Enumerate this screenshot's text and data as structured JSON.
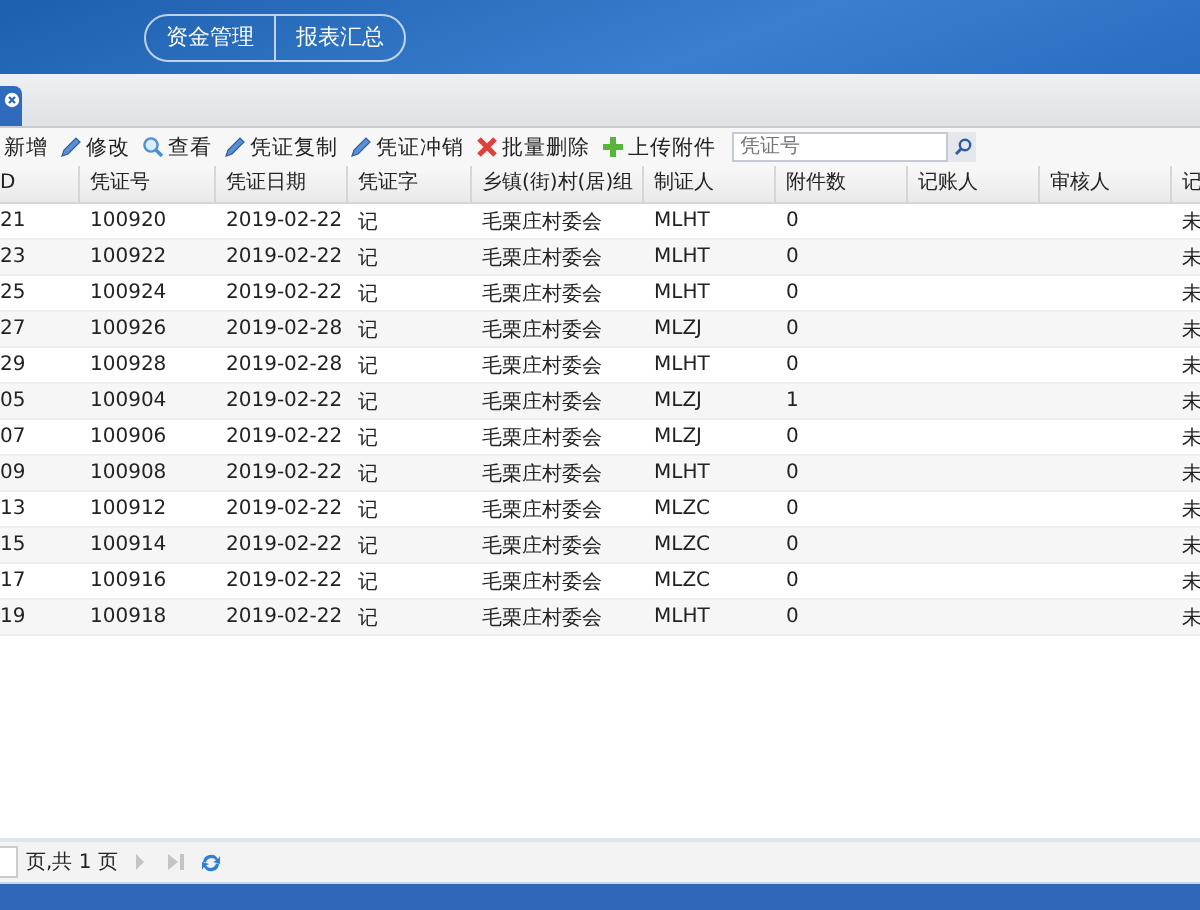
{
  "nav": [
    "资金管理",
    "报表汇总"
  ],
  "toolbar": [
    {
      "label": "新增"
    },
    {
      "label": "修改",
      "kind": "pencil"
    },
    {
      "label": "查看",
      "kind": "search"
    },
    {
      "label": "凭证复制",
      "kind": "pencil"
    },
    {
      "label": "凭证冲销",
      "kind": "pencil"
    },
    {
      "label": "批量删除",
      "kind": "delete"
    },
    {
      "label": "上传附件",
      "kind": "add"
    }
  ],
  "search": {
    "placeholder": "凭证号"
  },
  "table": {
    "columns": [
      "D",
      "凭证号",
      "凭证日期",
      "凭证字",
      "乡镇(街)村(居)组",
      "制证人",
      "附件数",
      "记账人",
      "审核人",
      "记"
    ],
    "rows": [
      [
        "21",
        "100920",
        "2019-02-22",
        "记",
        "毛栗庄村委会",
        "MLHT",
        "0",
        "",
        "",
        "未"
      ],
      [
        "23",
        "100922",
        "2019-02-22",
        "记",
        "毛栗庄村委会",
        "MLHT",
        "0",
        "",
        "",
        "未"
      ],
      [
        "25",
        "100924",
        "2019-02-22",
        "记",
        "毛栗庄村委会",
        "MLHT",
        "0",
        "",
        "",
        "未"
      ],
      [
        "27",
        "100926",
        "2019-02-28",
        "记",
        "毛栗庄村委会",
        "MLZJ",
        "0",
        "",
        "",
        "未"
      ],
      [
        "29",
        "100928",
        "2019-02-28",
        "记",
        "毛栗庄村委会",
        "MLHT",
        "0",
        "",
        "",
        "未"
      ],
      [
        "05",
        "100904",
        "2019-02-22",
        "记",
        "毛栗庄村委会",
        "MLZJ",
        "1",
        "",
        "",
        "未"
      ],
      [
        "07",
        "100906",
        "2019-02-22",
        "记",
        "毛栗庄村委会",
        "MLZJ",
        "0",
        "",
        "",
        "未"
      ],
      [
        "09",
        "100908",
        "2019-02-22",
        "记",
        "毛栗庄村委会",
        "MLHT",
        "0",
        "",
        "",
        "未"
      ],
      [
        "13",
        "100912",
        "2019-02-22",
        "记",
        "毛栗庄村委会",
        "MLZC",
        "0",
        "",
        "",
        "未"
      ],
      [
        "15",
        "100914",
        "2019-02-22",
        "记",
        "毛栗庄村委会",
        "MLZC",
        "0",
        "",
        "",
        "未"
      ],
      [
        "17",
        "100916",
        "2019-02-22",
        "记",
        "毛栗庄村委会",
        "MLZC",
        "0",
        "",
        "",
        "未"
      ],
      [
        "19",
        "100918",
        "2019-02-22",
        "记",
        "毛栗庄村委会",
        "MLHT",
        "0",
        "",
        "",
        "未"
      ]
    ]
  },
  "pager": {
    "text": "页,共 1 页"
  }
}
